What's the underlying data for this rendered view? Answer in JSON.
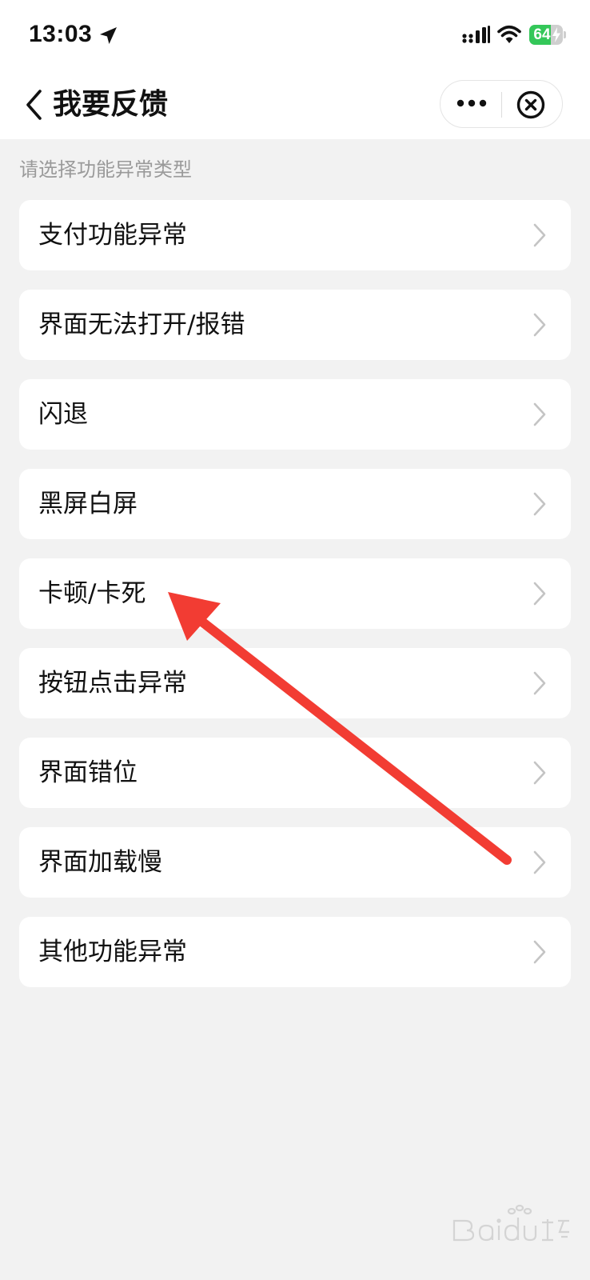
{
  "status_bar": {
    "time": "13:03",
    "battery_level": 64,
    "battery_text": "64"
  },
  "nav": {
    "title": "我要反馈"
  },
  "hint": "请选择功能异常类型",
  "items": [
    {
      "label": "支付功能异常"
    },
    {
      "label": "界面无法打开/报错"
    },
    {
      "label": "闪退"
    },
    {
      "label": "黑屏白屏"
    },
    {
      "label": "卡顿/卡死"
    },
    {
      "label": "按钮点击异常"
    },
    {
      "label": "界面错位"
    },
    {
      "label": "界面加载慢"
    },
    {
      "label": "其他功能异常"
    }
  ],
  "icons": {
    "back": "chevron-left-icon",
    "more": "more-dots-icon",
    "close": "close-circle-icon",
    "item": "chevron-right-icon",
    "annotation": "red-arrow-icon"
  },
  "colors": {
    "background": "#f2f2f2",
    "card": "#ffffff",
    "hint_text": "#9a9a9a",
    "chevron": "#c4c4c4",
    "battery": "#34c759",
    "annotation": "#f23c33"
  }
}
